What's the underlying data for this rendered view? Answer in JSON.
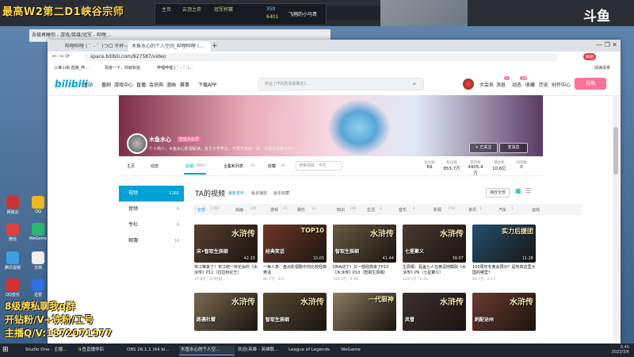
{
  "stream": {
    "title": "最高W2第二D1峡谷宗师",
    "platform_logo": "斗鱼",
    "overlay_lines": [
      "8级牌私聊我q群",
      "开钻粉/V+铁粉/工号",
      "主播Q/V:1872071977"
    ],
    "hud": {
      "tabs": [
        "主页",
        "云顶之弈",
        "冠军杯赛"
      ],
      "currency_1": "350",
      "currency_2": "6401",
      "player_name": "飞翔的小马哥"
    }
  },
  "background_window": {
    "tab_label": "吾极再睡你 - 游戏/英雄/冠军 - 哔哩..."
  },
  "browser": {
    "tabs": [
      {
        "label": "哔哩哔哩 ( ゜- ゜)つロ 干杯~-bi..."
      },
      {
        "label": "木鱼水心的个人空间_哔哩哔哩 (..."
      }
    ],
    "url": "space.bilibili.com/927587/video",
    "bookmarks": [
      "三维小街 直播_哔...",
      "百度一下，你就知道",
      "哔哩哔哩 ( ゜- ゜)..."
    ],
    "reading_list": "阅读清单",
    "ext_badge": "绘画"
  },
  "bili_header": {
    "logo": "bilibili",
    "nav": [
      "主站",
      "番剧",
      "游戏中心",
      "直播",
      "会员购",
      "漫画",
      "赛事",
      "下载APP"
    ],
    "search_placeholder": "命运了IF的剧场版确定2...",
    "user_nav": [
      "大会员",
      "消息",
      "动态",
      "收藏",
      "历史",
      "创作中心"
    ],
    "badges": {
      "message": "1",
      "dynamic": "19"
    },
    "upload": "投稿"
  },
  "profile": {
    "name": "木鱼水心",
    "badge": "年度大会员",
    "signature": "个人简介：木鱼水心影视解读，复旦大学毕业，不再冗余到一点，本期评论新不已一：...",
    "follow": "+ 已关注",
    "message": "发消息",
    "nav": [
      {
        "label": "主页",
        "count": ""
      },
      {
        "label": "动态",
        "count": ""
      },
      {
        "label": "投稿",
        "count": "999+"
      },
      {
        "label": "合集和列表",
        "count": "33"
      },
      {
        "label": "收藏",
        "count": "34"
      }
    ],
    "search_placeholder": "搜索视频、专栏",
    "stats": [
      {
        "label": "关注数",
        "value": "69"
      },
      {
        "label": "粉丝数",
        "value": "853.7万"
      },
      {
        "label": "获赞数",
        "value": "4905.4万"
      },
      {
        "label": "播放数",
        "value": "10.6亿"
      },
      {
        "label": "阅读数",
        "value": "0"
      }
    ]
  },
  "left_menu": [
    {
      "label": "视频",
      "count": "1160"
    },
    {
      "label": "音频",
      "count": "0"
    },
    {
      "label": "专栏",
      "count": "0"
    },
    {
      "label": "相簿",
      "count": "10"
    }
  ],
  "videos": {
    "title": "TA的视频",
    "sort": [
      "最新发布",
      "最多播放",
      "最多收藏"
    ],
    "play_all": "播放全部",
    "categories": [
      "全部",
      "1160",
      "动画",
      "146",
      "游戏",
      "41",
      "娱乐",
      "15",
      "知识",
      "196",
      "生活",
      "2",
      "音乐",
      "4",
      "影视",
      "756",
      "资讯",
      "1",
      "汽车",
      "1",
      "运动",
      "1"
    ],
    "cards": [
      {
        "thumb_text": "水浒传",
        "thumb_sub": "宋•智取生辰纲",
        "dur": "42:20",
        "title": "宋江等来了！宋江统一辩论会的《水浒传》P11（拉拉辩论王）",
        "meta": "37.9万 · 3小时前",
        "bg": "#5a4030"
      },
      {
        "thumb_text": "TOP10",
        "thumb_sub": "经典笑话",
        "dur": "10:03",
        "title": "一美人表：盘点影视剧中你比较经典笑话",
        "meta": "80.7万 · 3-2",
        "bg": "#703828"
      },
      {
        "thumb_text": "水浒传",
        "thumb_sub": "智取生辰纲",
        "dur": "41:44",
        "title": "DNA动了！又一部经典来了P10《水浒传》P10（智取生辰纲）",
        "meta": "120.3万 · 2-28",
        "bg": "#6a5a40"
      },
      {
        "thumb_text": "水浒传",
        "thumb_sub": "七星聚义",
        "dur": "39:07",
        "title": "生辰纲：晁盖七人在黄泥岗截取《水浒传》P9（七星聚义）",
        "meta": "120.5万 · 2-25",
        "bg": "#4a3a30"
      },
      {
        "thumb_text": "实力后援团",
        "thumb_sub": "",
        "dur": "11:28",
        "title": "100周年冬奥会预示？是你真这里大国的哪里？",
        "meta": "63.7万 · 2-17",
        "bg": "#205070"
      },
      {
        "thumb_text": "水浒传",
        "thumb_sub": "路遇杜稷",
        "dur": "",
        "title": "",
        "meta": "",
        "bg": "#7a6a50"
      },
      {
        "thumb_text": "水浒传",
        "thumb_sub": "智取生辰纲",
        "dur": "",
        "title": "",
        "meta": "",
        "bg": "#5a4a35"
      },
      {
        "thumb_text": "一代狠神",
        "thumb_sub": "",
        "dur": "",
        "title": "",
        "meta": "",
        "bg": "#8a7a60"
      },
      {
        "thumb_text": "水浒传",
        "thumb_sub": "风雪",
        "dur": "",
        "title": "",
        "meta": "",
        "bg": "#3a3030"
      },
      {
        "thumb_text": "水浒传",
        "thumb_sub": "刺配沧州",
        "dur": "",
        "title": "",
        "meta": "",
        "bg": "#6a3a30"
      }
    ]
  },
  "desktop_icons": [
    "网易云",
    "QQ",
    "微信",
    "WeGame",
    "腾讯视频",
    "文档",
    "QQ音乐",
    "迅雷"
  ],
  "taskbar": {
    "items": [
      "Studio One - 主播...",
      "斗鱼直播伴侣",
      "OBS 26.1.1 (64 bi...",
      "木鱼水心的个人空...",
      "欢迎(英雄 - 英雄联...",
      "League of Legends",
      "WeGame"
    ],
    "time": "0:45",
    "date": "2022/3/6"
  },
  "colors": {
    "accent": "#00a1d6",
    "pink": "#fb7299",
    "overlay": "#ffde59"
  }
}
